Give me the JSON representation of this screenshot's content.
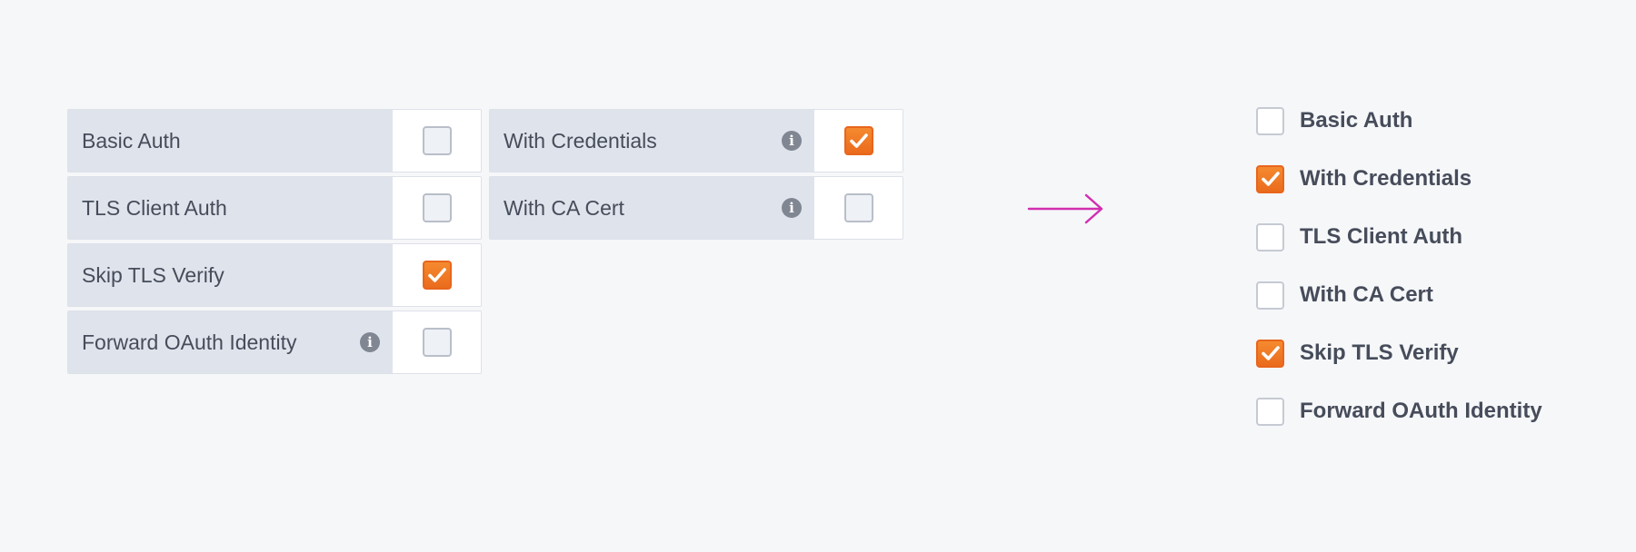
{
  "colors": {
    "page_background": "#f6f7f9",
    "label_background": "#dfe4ec",
    "text": "#464c5a",
    "checked_accent": "#ea6b1c",
    "arrow": "#d12fb0",
    "info_icon": "#808692"
  },
  "before": {
    "left_column": [
      {
        "label": "Basic Auth",
        "checked": false,
        "info_icon": false
      },
      {
        "label": "TLS Client Auth",
        "checked": false,
        "info_icon": false
      },
      {
        "label": "Skip TLS Verify",
        "checked": true,
        "info_icon": false
      },
      {
        "label": "Forward OAuth Identity",
        "checked": false,
        "info_icon": true
      }
    ],
    "right_column": [
      {
        "label": "With Credentials",
        "checked": true,
        "info_icon": true
      },
      {
        "label": "With CA Cert",
        "checked": false,
        "info_icon": true
      }
    ]
  },
  "arrow_icon": "right-arrow-icon",
  "after": {
    "items": [
      {
        "label": "Basic Auth",
        "checked": false
      },
      {
        "label": "With Credentials",
        "checked": true
      },
      {
        "label": "TLS Client Auth",
        "checked": false
      },
      {
        "label": "With CA Cert",
        "checked": false
      },
      {
        "label": "Skip TLS Verify",
        "checked": true
      },
      {
        "label": "Forward OAuth Identity",
        "checked": false
      }
    ]
  }
}
